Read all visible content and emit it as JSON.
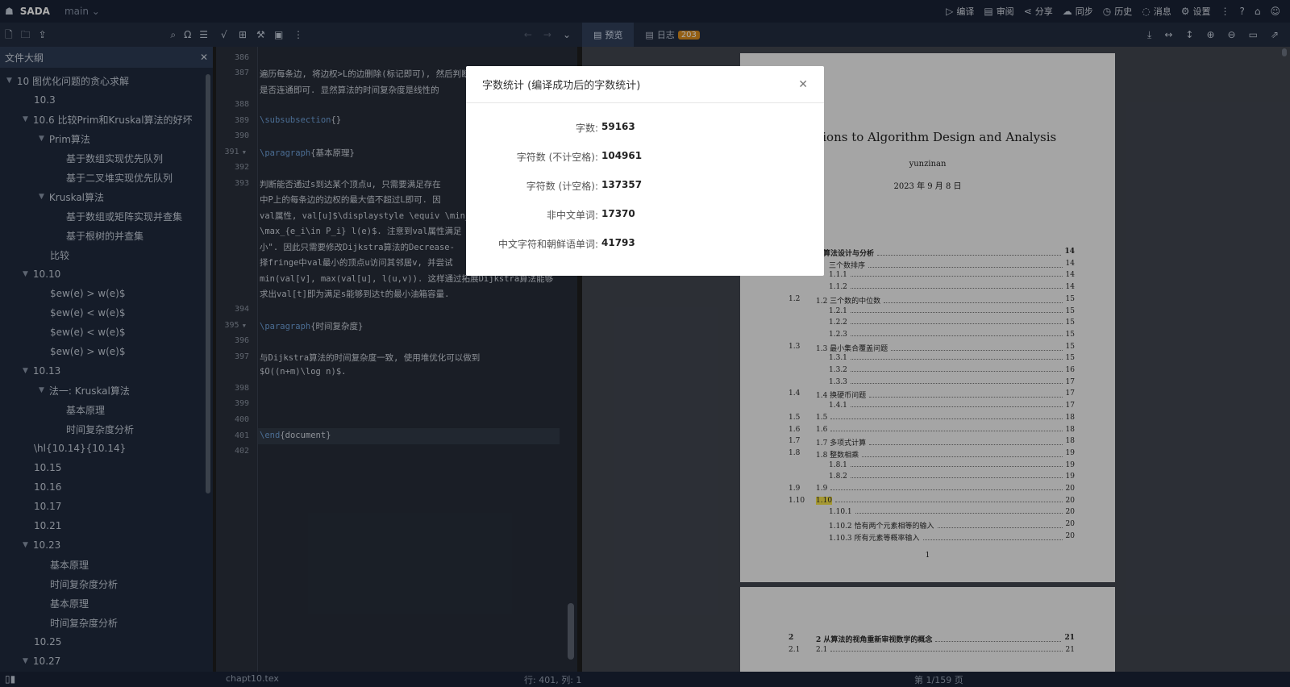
{
  "app": {
    "name": "SADA",
    "branch": "main"
  },
  "top_menu": [
    {
      "icon": "compile-icon",
      "label": "编译"
    },
    {
      "icon": "review-icon",
      "label": "审阅"
    },
    {
      "icon": "share-icon",
      "label": "分享"
    },
    {
      "icon": "sync-icon",
      "label": "同步"
    },
    {
      "icon": "history-icon",
      "label": "历史"
    },
    {
      "icon": "message-icon",
      "label": "消息"
    },
    {
      "icon": "settings-icon",
      "label": "设置"
    }
  ],
  "preview_tabs": {
    "preview": "预览",
    "log": "日志",
    "log_count": "203"
  },
  "sidebar": {
    "title": "文件大纲",
    "items": [
      {
        "label": "10 图优化问题的贪心求解",
        "level": 0,
        "collapsible": true
      },
      {
        "label": "10.3",
        "level": 1,
        "collapsible": false
      },
      {
        "label": "10.6 比较Prim和Kruskal算法的好坏",
        "level": 1,
        "collapsible": true
      },
      {
        "label": "Prim算法",
        "level": 2,
        "collapsible": true
      },
      {
        "label": "基于数组实现优先队列",
        "level": 3,
        "collapsible": false
      },
      {
        "label": "基于二叉堆实现优先队列",
        "level": 3,
        "collapsible": false
      },
      {
        "label": "Kruskal算法",
        "level": 2,
        "collapsible": true
      },
      {
        "label": "基于数组或矩阵实现并查集",
        "level": 3,
        "collapsible": false
      },
      {
        "label": "基于根树的并查集",
        "level": 3,
        "collapsible": false
      },
      {
        "label": "比较",
        "level": 2,
        "collapsible": false
      },
      {
        "label": "10.10",
        "level": 1,
        "collapsible": true
      },
      {
        "label": "$ew(e) > w(e)$",
        "level": 2,
        "collapsible": false
      },
      {
        "label": "$ew(e) < w(e)$",
        "level": 2,
        "collapsible": false
      },
      {
        "label": "$ew(e) < w(e)$",
        "level": 2,
        "collapsible": false
      },
      {
        "label": "$ew(e) > w(e)$",
        "level": 2,
        "collapsible": false
      },
      {
        "label": "10.13",
        "level": 1,
        "collapsible": true
      },
      {
        "label": "法一: Kruskal算法",
        "level": 2,
        "collapsible": true
      },
      {
        "label": "基本原理",
        "level": 3,
        "collapsible": false
      },
      {
        "label": "时间复杂度分析",
        "level": 3,
        "collapsible": false
      },
      {
        "label": "\\hl{10.14}{10.14}",
        "level": 1,
        "collapsible": false
      },
      {
        "label": "10.15",
        "level": 1,
        "collapsible": false
      },
      {
        "label": "10.16",
        "level": 1,
        "collapsible": false
      },
      {
        "label": "10.17",
        "level": 1,
        "collapsible": false
      },
      {
        "label": "10.21",
        "level": 1,
        "collapsible": false
      },
      {
        "label": "10.23",
        "level": 1,
        "collapsible": true
      },
      {
        "label": "基本原理",
        "level": 2,
        "collapsible": false
      },
      {
        "label": "时间复杂度分析",
        "level": 2,
        "collapsible": false
      },
      {
        "label": "基本原理",
        "level": 2,
        "collapsible": false
      },
      {
        "label": "时间复杂度分析",
        "level": 2,
        "collapsible": false
      },
      {
        "label": "10.25",
        "level": 1,
        "collapsible": false
      },
      {
        "label": "10.27",
        "level": 1,
        "collapsible": true
      }
    ]
  },
  "editor": {
    "lines": [
      {
        "n": "386",
        "text": ""
      },
      {
        "n": "387",
        "text": "遍历每条边, 将边权>L的边删除(标记即可), 然后判断s,t"
      },
      {
        "n": "",
        "text": "是否连通即可. 显然算法的时间复杂度是线性的"
      },
      {
        "n": "388",
        "text": ""
      },
      {
        "n": "389",
        "cmd": "\\subsubsection",
        "text": "{}"
      },
      {
        "n": "390",
        "text": ""
      },
      {
        "n": "391",
        "cmd": "\\paragraph",
        "text": "{基本原理}",
        "fold": true
      },
      {
        "n": "392",
        "text": ""
      },
      {
        "n": "393",
        "text": "判断能否通过s到达某个顶点u, 只需要满足存在"
      },
      {
        "n": "",
        "text": "中P上的每条边的边权的最大值不超过L即可. 因"
      },
      {
        "n": "",
        "text": "val属性, val[u]$\\displaystyle \\equiv \\min_"
      },
      {
        "n": "",
        "text": "\\max_{e_i\\in P_i} l(e)$. 注意到val属性满足"
      },
      {
        "n": "",
        "text": "小\". 因此只需要修改Dijkstra算法的Decrease-"
      },
      {
        "n": "",
        "text": "择fringe中val最小的顶点u访问其邻居v, 并尝试"
      },
      {
        "n": "",
        "text": "min(val[v], max(val[u], l(u,v)). 这样通过拓展Dijkstra算法能够"
      },
      {
        "n": "",
        "text": "求出val[t]即为满足s能够到达t的最小油箱容量."
      },
      {
        "n": "394",
        "text": ""
      },
      {
        "n": "395",
        "cmd": "\\paragraph",
        "text": "{时间复杂度}",
        "fold": true
      },
      {
        "n": "396",
        "text": ""
      },
      {
        "n": "397",
        "text": "与Dijkstra算法的时间复杂度一致, 使用堆优化可以做到"
      },
      {
        "n": "",
        "text": "$O((n+m)\\log n)$."
      },
      {
        "n": "398",
        "text": ""
      },
      {
        "n": "399",
        "text": ""
      },
      {
        "n": "400",
        "text": ""
      },
      {
        "n": "401",
        "cmd": "\\end",
        "text": "{document}",
        "current": true
      },
      {
        "n": "402",
        "text": ""
      }
    ]
  },
  "pdf": {
    "title": "olutions to Algorithm Design and Analysis",
    "author": "yunzinan",
    "date": "2023 年 9 月 8 日",
    "toc": [
      {
        "num": "",
        "title": "的算法设计与分析",
        "page": "14",
        "bold": true
      },
      {
        "num": "",
        "title": "三个数排序",
        "page": "14"
      },
      {
        "num": "",
        "title": "1.1.1",
        "page": "14"
      },
      {
        "num": "",
        "title": "1.1.2",
        "page": "14"
      },
      {
        "num": "1.2",
        "title": "1.2 三个数的中位数",
        "page": "15"
      },
      {
        "num": "",
        "title": "1.2.1",
        "page": "15"
      },
      {
        "num": "",
        "title": "1.2.2",
        "page": "15"
      },
      {
        "num": "",
        "title": "1.2.3",
        "page": "15"
      },
      {
        "num": "1.3",
        "title": "1.3 最小集合覆盖问题",
        "page": "15"
      },
      {
        "num": "",
        "title": "1.3.1",
        "page": "15"
      },
      {
        "num": "",
        "title": "1.3.2",
        "page": "16"
      },
      {
        "num": "",
        "title": "1.3.3",
        "page": "17"
      },
      {
        "num": "1.4",
        "title": "1.4 换硬币问题",
        "page": "17"
      },
      {
        "num": "",
        "title": "1.4.1",
        "page": "17"
      },
      {
        "num": "1.5",
        "title": "1.5",
        "page": "18"
      },
      {
        "num": "1.6",
        "title": "1.6",
        "page": "18"
      },
      {
        "num": "1.7",
        "title": "1.7 多项式计算",
        "page": "18"
      },
      {
        "num": "1.8",
        "title": "1.8 整数相乘",
        "page": "19"
      },
      {
        "num": "",
        "title": "1.8.1",
        "page": "19"
      },
      {
        "num": "",
        "title": "1.8.2",
        "page": "19"
      },
      {
        "num": "1.9",
        "title": "1.9",
        "page": "20"
      },
      {
        "num": "1.10",
        "title": "1.10",
        "page": "20",
        "highlight": true
      },
      {
        "num": "",
        "title": "1.10.1",
        "page": "20"
      },
      {
        "num": "",
        "title": "1.10.2  恰有两个元素相等的输入",
        "page": "20"
      },
      {
        "num": "",
        "title": "1.10.3  所有元素等概率输入",
        "page": "20"
      }
    ],
    "page_number": "1",
    "page2_rows": [
      {
        "num": "2",
        "title": "2 从算法的视角重新审视数学的概念",
        "page": "21",
        "bold": true
      },
      {
        "num": "2.1",
        "title": "2.1",
        "page": "21"
      }
    ]
  },
  "status": {
    "file": "chapt10.tex",
    "cursor": "行: 401, 列: 1",
    "page": "第 1/159 页"
  },
  "modal": {
    "title": "字数统计 (编译成功后的字数统计)",
    "stats": [
      {
        "label": "字数:",
        "value": "59163"
      },
      {
        "label": "字符数 (不计空格):",
        "value": "104961"
      },
      {
        "label": "字符数 (计空格):",
        "value": "137357"
      },
      {
        "label": "非中文单词:",
        "value": "17370"
      },
      {
        "label": "中文字符和朝鲜语单词:",
        "value": "41793"
      }
    ]
  }
}
